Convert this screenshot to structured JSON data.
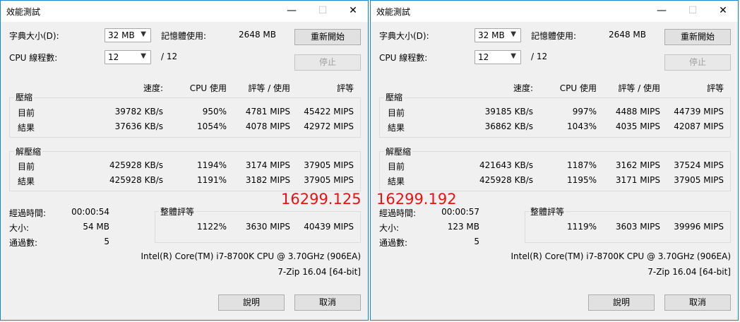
{
  "windows": [
    {
      "title": "效能測試",
      "dict_label": "字典大小(D):",
      "dict_value": "32 MB",
      "mem_label": "記憶體使用:",
      "mem_value": "2648 MB",
      "restart_button": "重新開始",
      "cpu_threads_label": "CPU 線程數:",
      "cpu_threads_value": "12",
      "cpu_threads_total": "/ 12",
      "stop_button": "停止",
      "headers": {
        "speed": "速度:",
        "cpu_usage": "CPU 使用",
        "rating_usage": "評等 / 使用",
        "rating": "評等"
      },
      "compress": {
        "label": "壓縮",
        "rows": [
          {
            "label": "目前",
            "speed": "39782 KB/s",
            "cpu": "950%",
            "rating_usage": "4781 MIPS",
            "rating": "45422 MIPS"
          },
          {
            "label": "結果",
            "speed": "37636 KB/s",
            "cpu": "1054%",
            "rating_usage": "4078 MIPS",
            "rating": "42972 MIPS"
          }
        ]
      },
      "decompress": {
        "label": "解壓縮",
        "rows": [
          {
            "label": "目前",
            "speed": "425928 KB/s",
            "cpu": "1194%",
            "rating_usage": "3174 MIPS",
            "rating": "37905 MIPS"
          },
          {
            "label": "結果",
            "speed": "425928 KB/s",
            "cpu": "1191%",
            "rating_usage": "3182 MIPS",
            "rating": "37905 MIPS"
          }
        ]
      },
      "elapsed_label": "經過時間:",
      "elapsed_value": "00:00:54",
      "size_label": "大小:",
      "size_value": "54 MB",
      "passes_label": "通過數:",
      "passes_value": "5",
      "total_label": "整體評等",
      "total": {
        "cpu": "1122%",
        "rating_usage": "3630 MIPS",
        "rating": "40439 MIPS"
      },
      "cpu_name": "Intel(R) Core(TM) i7-8700K CPU @ 3.70GHz (906EA)",
      "version": "7-Zip 16.04 [64-bit]",
      "help_button": "說明",
      "cancel_button": "取消"
    },
    {
      "title": "效能測試",
      "dict_label": "字典大小(D):",
      "dict_value": "32 MB",
      "mem_label": "記憶體使用:",
      "mem_value": "2648 MB",
      "restart_button": "重新開始",
      "cpu_threads_label": "CPU 線程數:",
      "cpu_threads_value": "12",
      "cpu_threads_total": "/ 12",
      "stop_button": "停止",
      "headers": {
        "speed": "速度:",
        "cpu_usage": "CPU 使用",
        "rating_usage": "評等 / 使用",
        "rating": "評等"
      },
      "compress": {
        "label": "壓縮",
        "rows": [
          {
            "label": "目前",
            "speed": "39185 KB/s",
            "cpu": "997%",
            "rating_usage": "4488 MIPS",
            "rating": "44739 MIPS"
          },
          {
            "label": "結果",
            "speed": "36862 KB/s",
            "cpu": "1043%",
            "rating_usage": "4035 MIPS",
            "rating": "42087 MIPS"
          }
        ]
      },
      "decompress": {
        "label": "解壓縮",
        "rows": [
          {
            "label": "目前",
            "speed": "421643 KB/s",
            "cpu": "1187%",
            "rating_usage": "3162 MIPS",
            "rating": "37524 MIPS"
          },
          {
            "label": "結果",
            "speed": "425928 KB/s",
            "cpu": "1195%",
            "rating_usage": "3171 MIPS",
            "rating": "37905 MIPS"
          }
        ]
      },
      "elapsed_label": "經過時間:",
      "elapsed_value": "00:00:57",
      "size_label": "大小:",
      "size_value": "123 MB",
      "passes_label": "通過數:",
      "passes_value": "5",
      "total_label": "整體評等",
      "total": {
        "cpu": "1119%",
        "rating_usage": "3603 MIPS",
        "rating": "39996 MIPS"
      },
      "cpu_name": "Intel(R) Core(TM) i7-8700K CPU @ 3.70GHz (906EA)",
      "version": "7-Zip 16.04 [64-bit]",
      "help_button": "說明",
      "cancel_button": "取消"
    }
  ],
  "overlay": {
    "left_score": "16299.125",
    "right_score": "16299.192",
    "color": "#ee1111"
  },
  "window_chrome": {
    "minimize": "—",
    "maximize": "☐",
    "close": "✕"
  }
}
